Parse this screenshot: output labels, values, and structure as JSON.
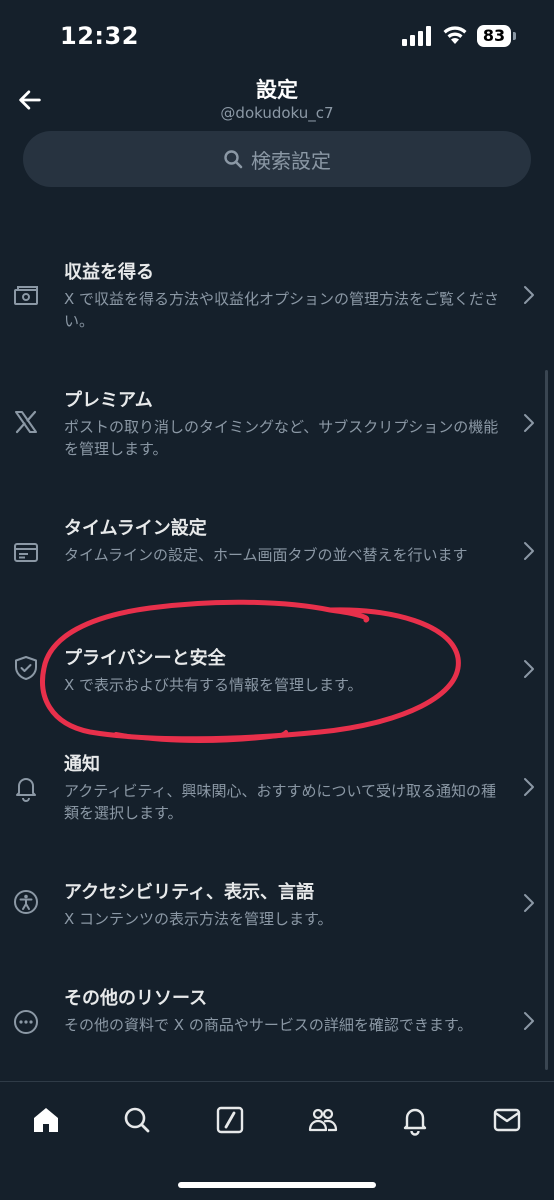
{
  "status_bar": {
    "time": "12:32",
    "battery": "83"
  },
  "header": {
    "title": "設定",
    "subtitle": "@dokudoku_c7",
    "back_icon": "arrow-left-icon"
  },
  "search": {
    "placeholder": "検索設定",
    "icon": "search-icon"
  },
  "settings": {
    "items": [
      {
        "title": "収益を得る",
        "description": "X で収益を得る方法や収益化オプションの管理方法をご覧ください。",
        "icon": "money-icon"
      },
      {
        "title": "プレミアム",
        "description": "ポストの取り消しのタイミングなど、サブスクリプションの機能を管理します。",
        "icon": "x-logo-icon"
      },
      {
        "title": "タイムライン設定",
        "description": "タイムラインの設定、ホーム画面タブの並べ替えを行います",
        "icon": "timeline-icon"
      },
      {
        "title": "プライバシーと安全",
        "description": "X で表示および共有する情報を管理します。",
        "icon": "shield-icon"
      },
      {
        "title": "通知",
        "description": "アクティビティ、興味関心、おすすめについて受け取る通知の種類を選択します。",
        "icon": "bell-icon"
      },
      {
        "title": "アクセシビリティ、表示、言語",
        "description": "X コンテンツの表示方法を管理します。",
        "icon": "accessibility-icon"
      },
      {
        "title": "その他のリソース",
        "description": "その他の資料で X の商品やサービスの詳細を確認できます。",
        "icon": "more-circle-icon"
      }
    ]
  },
  "annotation": {
    "color": "#e8304b"
  },
  "bottom_nav": {
    "items": [
      {
        "icon": "home-icon"
      },
      {
        "icon": "search-icon"
      },
      {
        "icon": "grok-icon"
      },
      {
        "icon": "communities-icon"
      },
      {
        "icon": "bell-icon"
      },
      {
        "icon": "mail-icon"
      }
    ]
  },
  "colors": {
    "background": "#15202b",
    "text_primary": "#e7e9ea",
    "text_secondary": "#8b98a5",
    "search_bg": "#273340"
  }
}
